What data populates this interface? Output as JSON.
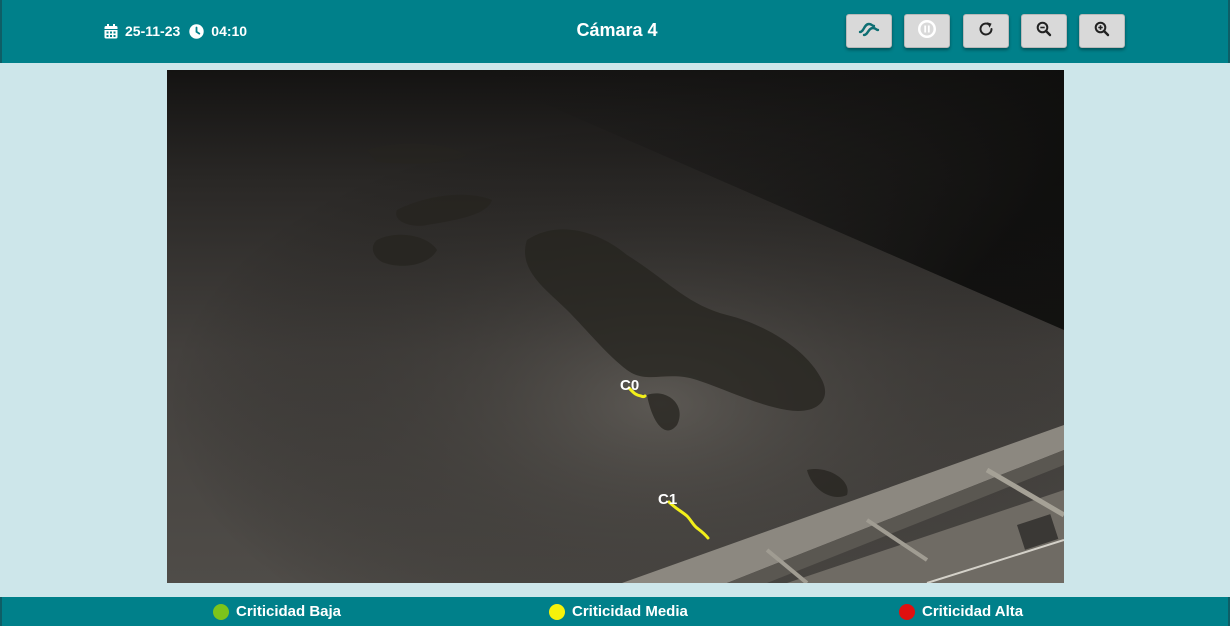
{
  "header": {
    "date": "25-11-23",
    "time": "04:10",
    "title": "Cámara 4",
    "controls": [
      {
        "icon": "waves-icon"
      },
      {
        "icon": "pause-icon"
      },
      {
        "icon": "refresh-icon"
      },
      {
        "icon": "zoom-out-icon"
      },
      {
        "icon": "zoom-in-icon"
      }
    ]
  },
  "camera": {
    "detections": [
      {
        "label": "C0",
        "color": "#f2ef1a"
      },
      {
        "label": "C1",
        "color": "#f2ef1a"
      }
    ]
  },
  "legend": {
    "items": [
      {
        "label": "Criticidad Baja",
        "color": "#7cc41a"
      },
      {
        "label": "Criticidad Media",
        "color": "#f5f20a"
      },
      {
        "label": "Criticidad Alta",
        "color": "#e01010"
      }
    ]
  },
  "colors": {
    "bar": "#00808a",
    "background": "#cde6ea",
    "button": "#d9d9d9"
  }
}
